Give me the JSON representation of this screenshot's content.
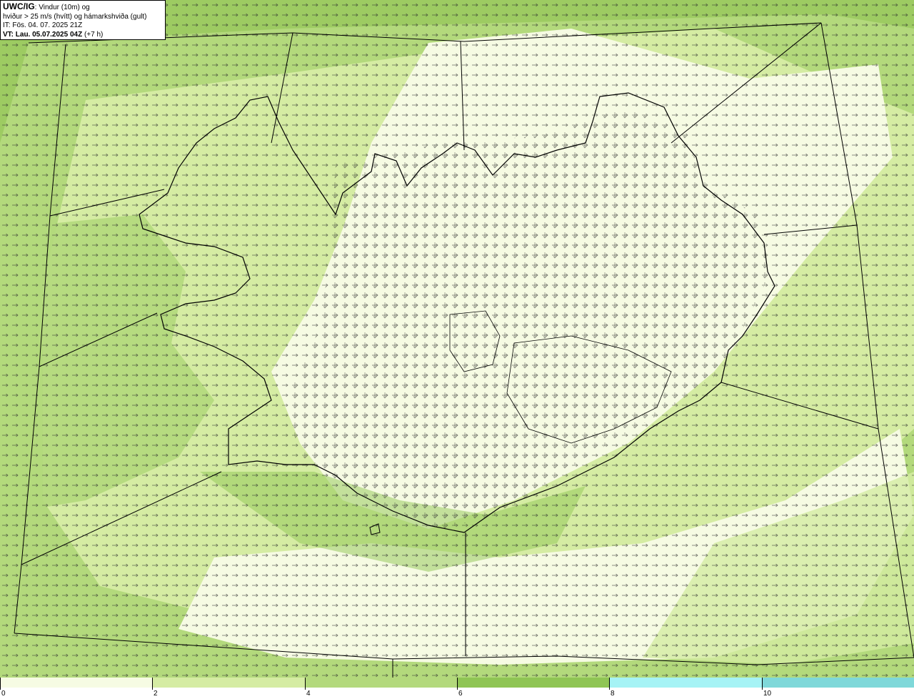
{
  "info": {
    "code": "UWC/IG",
    "line1_rest": ": Vindur (10m) og",
    "line2": "hviður > 25 m/s (hvítt) og hámarkshviða (gult)",
    "line3": "IT: Fös. 04. 07. 2025 21Z",
    "line4_bold": "VT: Lau. 05.07.2025 04Z",
    "line4_rest": " (+7 h)"
  },
  "colorbar": {
    "levels": [
      {
        "from": 0,
        "to": 2,
        "color": "#f6fbe3"
      },
      {
        "from": 2,
        "to": 4,
        "color": "#d5eca3"
      },
      {
        "from": 4,
        "to": 6,
        "color": "#b3d97c"
      },
      {
        "from": 6,
        "to": 8,
        "color": "#8fc554"
      },
      {
        "from": 8,
        "to": 10,
        "color": "#a6f3f5"
      },
      {
        "from": 10,
        "to": 12,
        "color": "#7fd8d9"
      }
    ],
    "tick_labels": [
      "0",
      "2",
      "4",
      "6",
      "8",
      "10"
    ]
  },
  "map": {
    "wind_field_colors": {
      "calm": "#f6fbe3",
      "light": "#d5eca3",
      "moderate": "#b3d97c",
      "fresh": "#8fc554"
    },
    "coast_color": "#000000",
    "arrow_color": "#222222"
  }
}
